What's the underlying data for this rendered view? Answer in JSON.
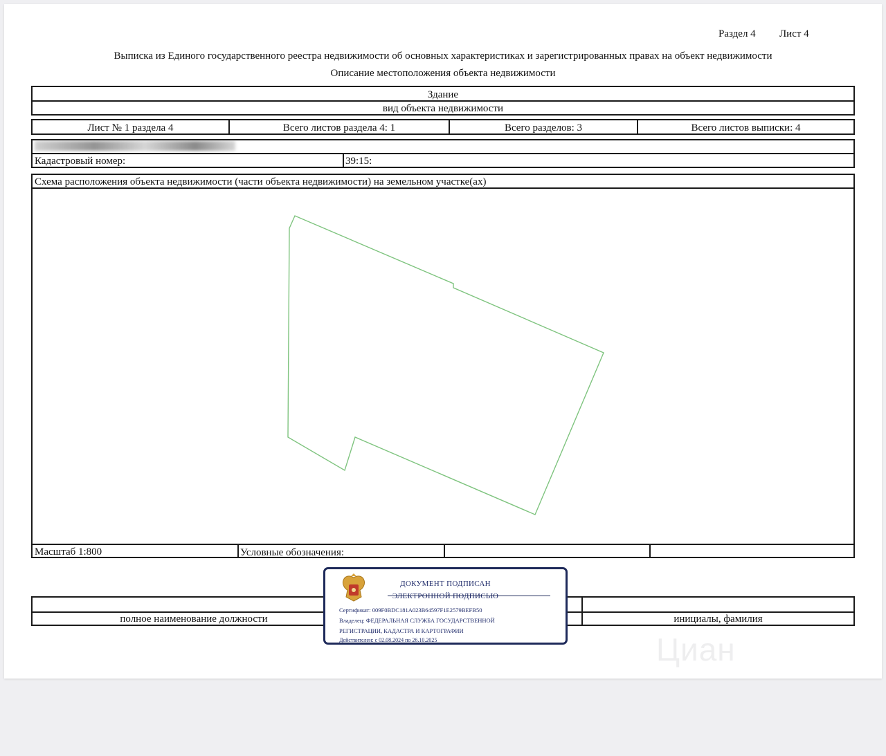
{
  "header": {
    "section": "Раздел 4",
    "sheet": "Лист 4",
    "title": "Выписка из Единого государственного реестра недвижимости об основных характеристиках и зарегистрированных правах на объект недвижимости",
    "subtitle": "Описание местоположения объекта недвижимости"
  },
  "object": {
    "type": "Здание",
    "type_caption": "вид объекта недвижимости"
  },
  "sheet_info": {
    "sheet_no": "Лист № 1 раздела 4",
    "total_section_sheets": "Всего листов раздела 4: 1",
    "total_sections": "Всего разделов: 3",
    "total_extract_sheets": "Всего листов выписки: 4"
  },
  "cadastral": {
    "label": "Кадастровый номер:",
    "value": "39:15:"
  },
  "scheme": {
    "title": "Схема расположения объекта недвижимости (части объекта недвижимости) на земельном участке(ах)",
    "outline_color": "#7fc47f"
  },
  "footer": {
    "scale": "Масштаб 1:800",
    "legend_label": "Условные обозначения:",
    "position_caption": "полное наименование должности",
    "name_caption": "инициалы, фамилия"
  },
  "stamp": {
    "emblem": "coat-of-arms-icon",
    "line1": "ДОКУМЕНТ ПОДПИСАН",
    "line2": "ЭЛЕКТРОННОЙ ПОДПИСЬЮ",
    "certificate": "Сертификат: 009F0BDC181A023B64597F1E2579BEFB50",
    "owner1": "Владелец: ФЕДЕРАЛЬНАЯ СЛУЖБА ГОСУДАРСТВЕННОЙ",
    "owner2": "РЕГИСТРАЦИИ, КАДАСТРА И КАРТОГРАФИИ",
    "validity": "Действителен: с 02.08.2024 по 26.10.2025",
    "color": "#1e2a5a"
  },
  "watermark": "Циан"
}
